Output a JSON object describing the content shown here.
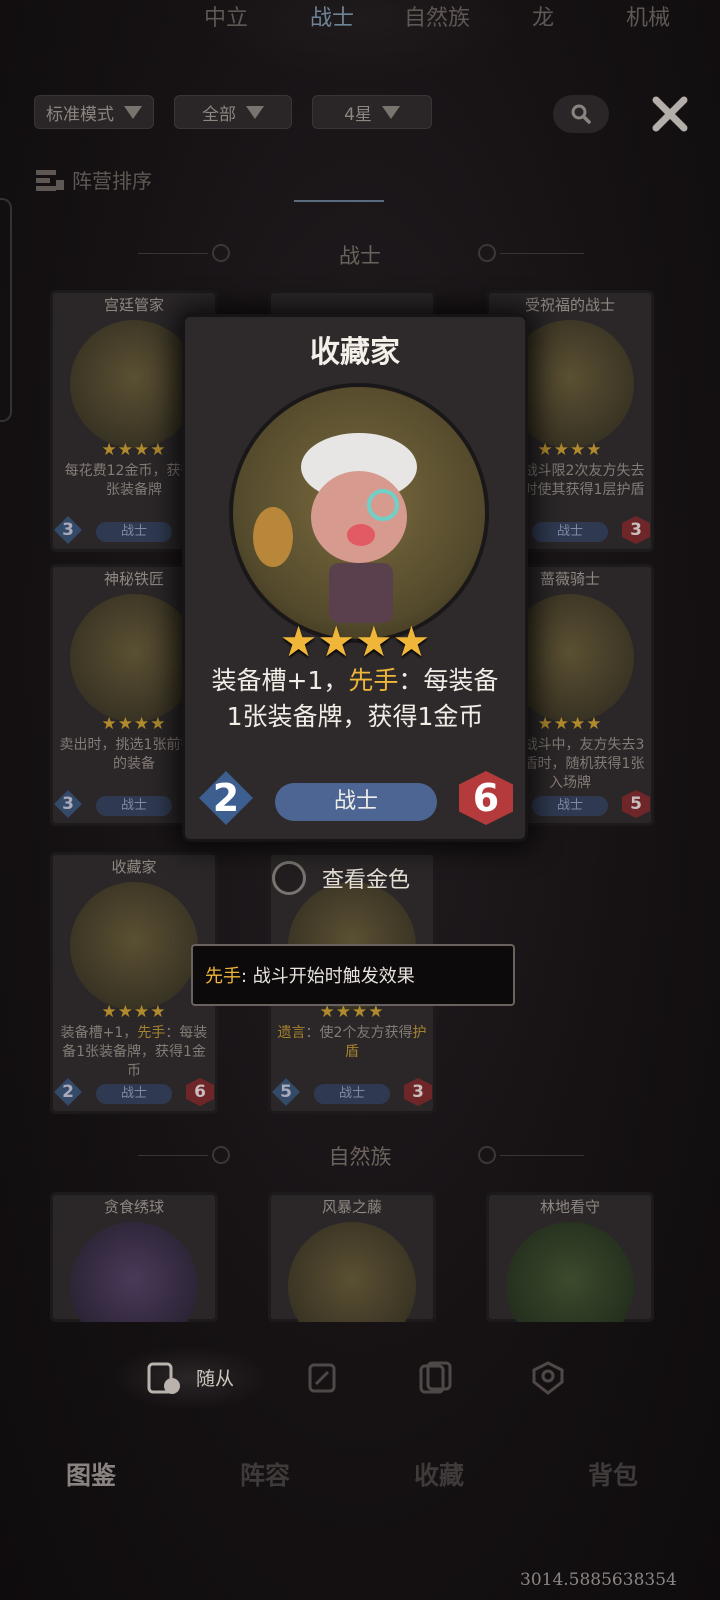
{
  "filters": {
    "mode": "标准模式",
    "scope": "全部",
    "stars": "4星"
  },
  "tabs": {
    "sort_label": "阵营排序",
    "items": [
      "中立",
      "战士",
      "自然族",
      "龙",
      "机械"
    ],
    "active": "战士"
  },
  "sections": {
    "warrior": "战士",
    "nature": "自然族"
  },
  "cards": [
    {
      "name": "宫廷管家",
      "desc": "每花费12金币，获得1张装备牌",
      "cost": "3",
      "tribe": "战士",
      "atk": ""
    },
    {
      "name": "受祝福的战士",
      "desc": "每场战斗限2次友方失去护盾时使其获得1层护盾",
      "cost": "",
      "tribe": "战士",
      "atk": "3"
    },
    {
      "name": "神秘铁匠",
      "desc": "卖出时，挑选1张前等级的装备",
      "cost": "3",
      "tribe": "战士",
      "atk": ""
    },
    {
      "name": "蔷薇骑士",
      "desc": "单次战斗中，友方失去3次护盾时，随机获得1张入场牌",
      "cost": "",
      "tribe": "战士",
      "atk": "5"
    },
    {
      "name": "收藏家",
      "desc_parts": [
        "装备槽+1，",
        "先手",
        "：每装备1张装备牌，获得1金币"
      ],
      "cost": "2",
      "tribe": "战士",
      "atk": "6"
    },
    {
      "name": "",
      "desc_parts": [
        "遗言",
        "：使2个友方获得",
        "护盾"
      ],
      "cost": "5",
      "tribe": "战士",
      "atk": "3"
    }
  ],
  "nature_cards": [
    {
      "name": "贪食绣球"
    },
    {
      "name": "风暴之藤"
    },
    {
      "name": "林地看守"
    }
  ],
  "featured_card": {
    "name": "收藏家",
    "stars": 4,
    "desc_prefix": "装备槽+1，",
    "desc_keyword": "先手",
    "desc_rest": "：每装备1张装备牌，获得1金币",
    "cost": "2",
    "tribe": "战士",
    "attack": "6"
  },
  "gold_toggle": {
    "label": "查看金色",
    "checked": false
  },
  "tooltip": {
    "keyword": "先手",
    "text": ": 战斗开始时触发效果"
  },
  "sub_tabs": {
    "active_label": "随从",
    "icons": [
      "minion-icon",
      "card-icon",
      "cards-icon",
      "hero-icon"
    ]
  },
  "main_nav": {
    "items": [
      "图鉴",
      "阵容",
      "收藏",
      "背包"
    ],
    "active": "图鉴"
  },
  "version": "3014.5885638354",
  "colors": {
    "gold": "#f0b63a",
    "tribe_blue": "#4d6592",
    "attack_red": "#b53a3b",
    "cost_blue": "#3c5f90"
  }
}
